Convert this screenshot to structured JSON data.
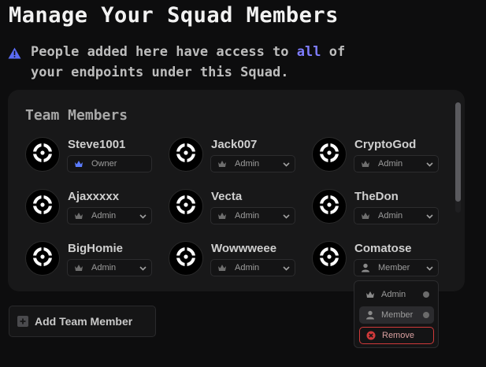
{
  "page": {
    "title": "Manage Your Squad Members",
    "notice": {
      "icon": "warning-icon",
      "line1_before": "People added here have access to ",
      "line1_highlight": "all",
      "line1_after": " of",
      "line2": "your endpoints under this Squad."
    }
  },
  "panel": {
    "title": "Team Members",
    "members": [
      {
        "name": "Steve1001",
        "role": "Owner",
        "role_icon": "crown-icon"
      },
      {
        "name": "Jack007",
        "role": "Admin",
        "role_icon": "crown-icon"
      },
      {
        "name": "CryptoGod",
        "role": "Admin",
        "role_icon": "crown-icon"
      },
      {
        "name": "Ajaxxxxx",
        "role": "Admin",
        "role_icon": "crown-icon"
      },
      {
        "name": "Vecta",
        "role": "Admin",
        "role_icon": "crown-icon"
      },
      {
        "name": "TheDon",
        "role": "Admin",
        "role_icon": "crown-icon"
      },
      {
        "name": "BigHomie",
        "role": "Admin",
        "role_icon": "crown-icon"
      },
      {
        "name": "Wowwweee",
        "role": "Admin",
        "role_icon": "crown-icon"
      },
      {
        "name": "Comatose",
        "role": "Member",
        "role_icon": "user-icon"
      }
    ]
  },
  "role_menu": {
    "options": [
      {
        "label": "Admin",
        "icon": "crown-icon"
      },
      {
        "label": "Member",
        "icon": "user-icon",
        "selected": true
      },
      {
        "label": "Remove",
        "icon": "remove-icon"
      }
    ]
  },
  "add_button": {
    "label": "Add Team Member",
    "icon": "plus-icon"
  },
  "colors": {
    "background": "#0d0d0e",
    "panel": "#181819",
    "accent": "#7f7dff",
    "danger": "#d03a3a",
    "owner_crown": "#5b7cff"
  }
}
